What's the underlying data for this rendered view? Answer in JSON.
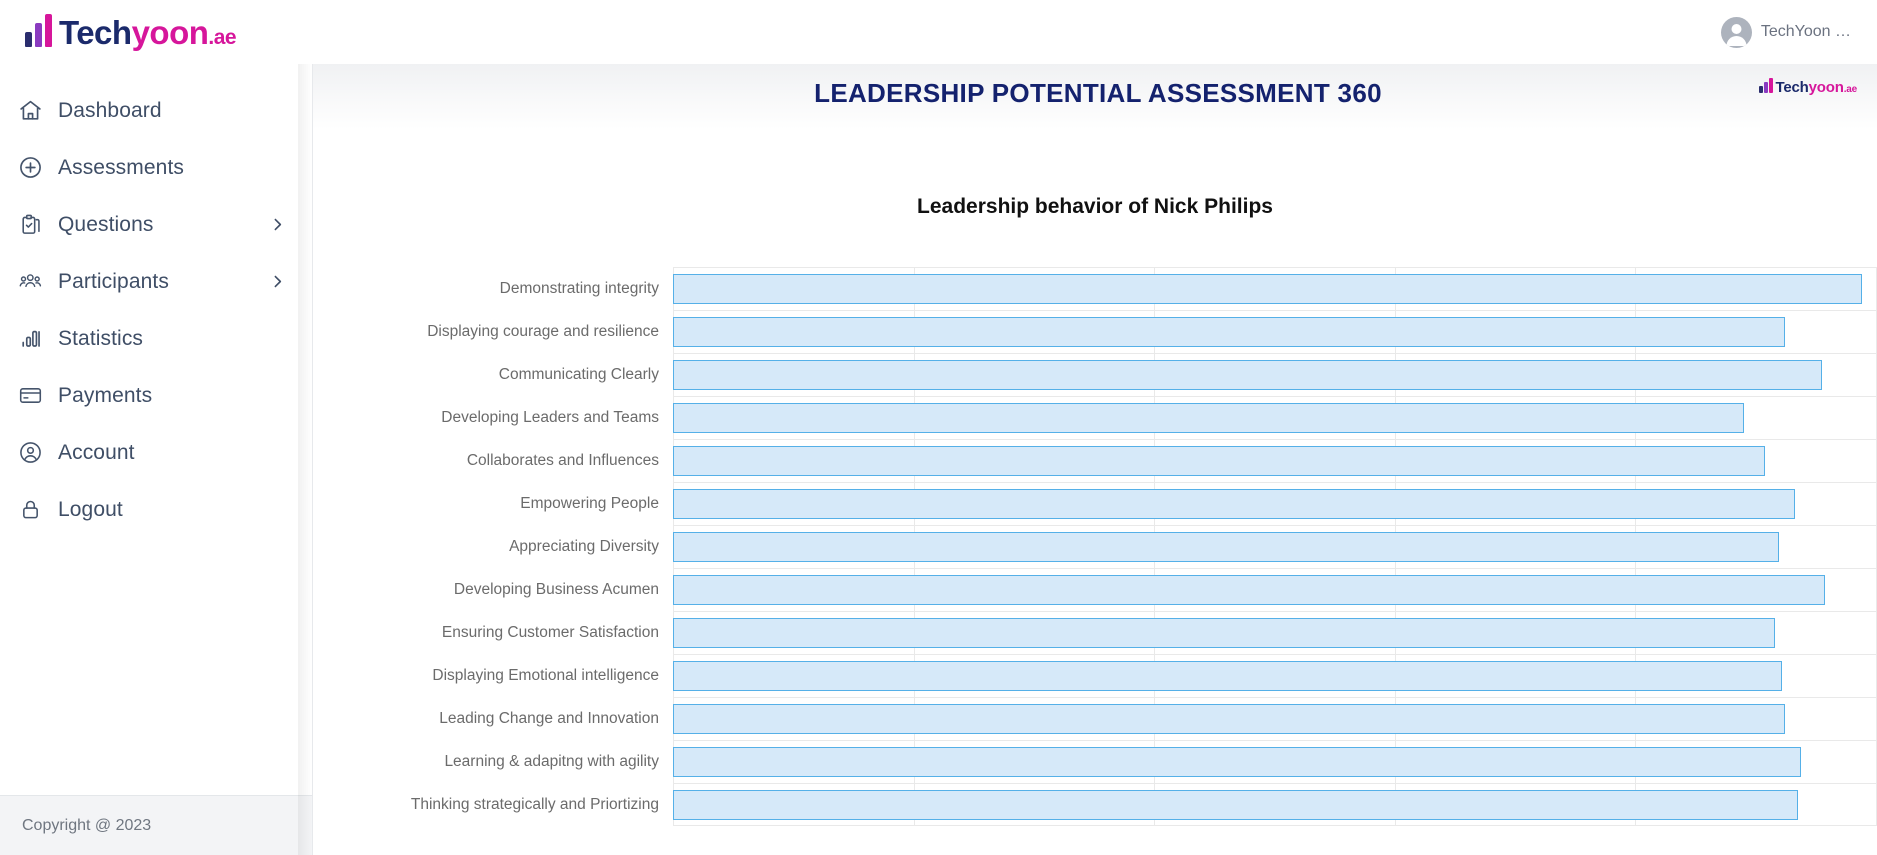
{
  "brand": {
    "logo_icon": "bar-chart-logo-icon",
    "part1": "Tech",
    "part2": "yoon",
    "part3": "",
    "suffix": ".ae",
    "accent_navy": "#1b2a6b",
    "accent_magenta": "#d6169b",
    "accent_purple": "#8a3bc0"
  },
  "topbar": {
    "user_name": "TechYoon …",
    "avatar_icon": "user-avatar-icon"
  },
  "sidebar": {
    "items": [
      {
        "label": "Dashboard",
        "icon": "home-icon",
        "chevron": false
      },
      {
        "label": "Assessments",
        "icon": "plus-circle-icon",
        "chevron": false
      },
      {
        "label": "Questions",
        "icon": "clipboard-check-icon",
        "chevron": true
      },
      {
        "label": "Participants",
        "icon": "users-group-icon",
        "chevron": true
      },
      {
        "label": "Statistics",
        "icon": "bar-chart-icon",
        "chevron": false
      },
      {
        "label": "Payments",
        "icon": "credit-card-icon",
        "chevron": false
      },
      {
        "label": "Account",
        "icon": "user-circle-icon",
        "chevron": false
      },
      {
        "label": "Logout",
        "icon": "lock-icon",
        "chevron": false
      }
    ],
    "copyright": "Copyright @ 2023"
  },
  "content": {
    "page_title": "LEADERSHIP POTENTIAL ASSESSMENT 360",
    "page_title_color": "#14226e",
    "mini_logo_icon": "techyoon-mini-logo-icon"
  },
  "chart_data": {
    "type": "bar",
    "orientation": "horizontal",
    "title": "Leadership behavior of Nick Philips",
    "xlabel": "",
    "ylabel": "",
    "xlim": [
      0,
      5
    ],
    "grid": true,
    "gridline_count": 6,
    "legend": "none",
    "bar_fill": "#d6e9f9",
    "bar_border": "#55b0e8",
    "categories": [
      "Demonstrating integrity",
      "Displaying courage and resilience",
      "Communicating Clearly",
      "Developing Leaders and Teams",
      "Collaborates and Influences",
      "Empowering People",
      "Appreciating Diversity",
      "Developing Business Acumen",
      "Ensuring Customer Satisfaction",
      "Displaying Emotional intelligence",
      "Leading Change and Innovation",
      "Learning & adapitng with agility",
      "Thinking strategically and Priortizing"
    ],
    "values": [
      4.94,
      4.62,
      4.78,
      4.45,
      4.54,
      4.67,
      4.6,
      4.79,
      4.58,
      4.61,
      4.62,
      4.69,
      4.68
    ],
    "values_percent": [
      98.8,
      92.4,
      95.5,
      89.0,
      90.8,
      93.3,
      91.9,
      95.8,
      91.6,
      92.2,
      92.4,
      93.8,
      93.5
    ]
  }
}
